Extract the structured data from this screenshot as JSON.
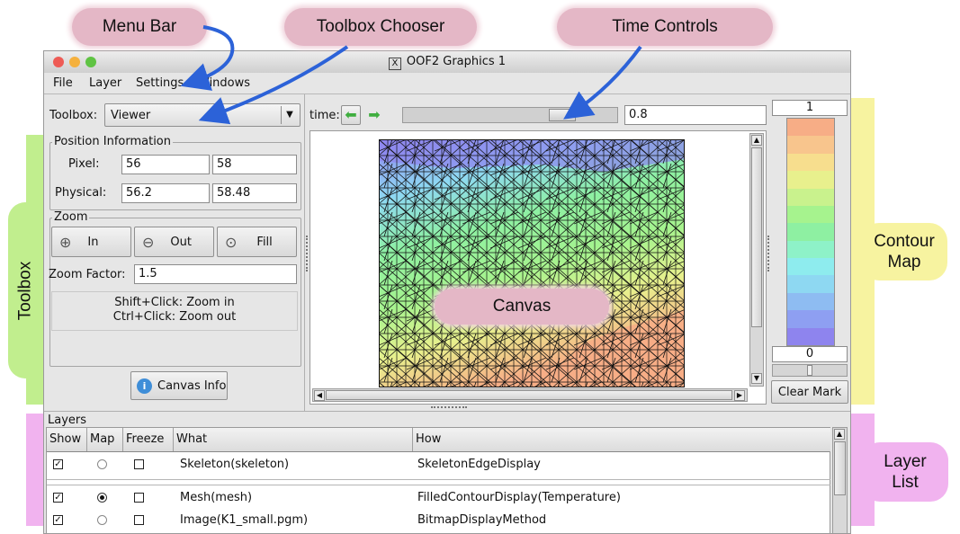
{
  "annotations": {
    "menu_bar": "Menu Bar",
    "toolbox_chooser": "Toolbox Chooser",
    "time_controls": "Time Controls",
    "toolbox": "Toolbox",
    "contour_map_line1": "Contour",
    "contour_map_line2": "Map",
    "layer_list_line1": "Layer",
    "layer_list_line2": "List",
    "canvas": "Canvas"
  },
  "window": {
    "title": "OOF2 Graphics 1",
    "title_icon": "X",
    "traffic_colors": [
      "#ee5b55",
      "#f5b13e",
      "#5fc343"
    ]
  },
  "menu": [
    "File",
    "Layer",
    "Settings",
    "Windows"
  ],
  "toolbox": {
    "label": "Toolbox:",
    "selected": "Viewer",
    "position_title": "Position Information",
    "pixel_label": "Pixel:",
    "pixel_x": "56",
    "pixel_y": "58",
    "physical_label": "Physical:",
    "physical_x": "56.2",
    "physical_y": "58.48",
    "zoom_title": "Zoom",
    "zoom_in": "In",
    "zoom_out": "Out",
    "zoom_fill": "Fill",
    "zoom_factor_label": "Zoom Factor:",
    "zoom_factor": "1.5",
    "hint_line1": "Shift+Click: Zoom in",
    "hint_line2": "Ctrl+Click: Zoom out",
    "canvas_info": "Canvas Info"
  },
  "time": {
    "label": "time:",
    "value": "0.8",
    "slider_position": 0.78
  },
  "contour": {
    "max": "1",
    "min": "0",
    "clear_mark": "Clear Mark",
    "bands": [
      "#f7ad86",
      "#f8c58d",
      "#f7de8e",
      "#e8f08d",
      "#c9f28d",
      "#a6f38e",
      "#8ef0a2",
      "#8ef2c8",
      "#8eecee",
      "#8ed8f2",
      "#8ebcf2",
      "#8e9ff2",
      "#8e84ee"
    ]
  },
  "layers": {
    "title": "Layers",
    "columns": [
      "Show",
      "Map",
      "Freeze",
      "What",
      "How"
    ],
    "rows": [
      {
        "show": true,
        "map": false,
        "freeze": false,
        "what": "Skeleton(skeleton)",
        "how": "SkeletonEdgeDisplay"
      },
      {
        "show": true,
        "map": true,
        "freeze": false,
        "what": "Mesh(mesh)",
        "how": "FilledContourDisplay(Temperature)"
      },
      {
        "show": true,
        "map": false,
        "freeze": false,
        "what": "Image(K1_small.pgm)",
        "how": "BitmapDisplayMethod"
      }
    ]
  }
}
